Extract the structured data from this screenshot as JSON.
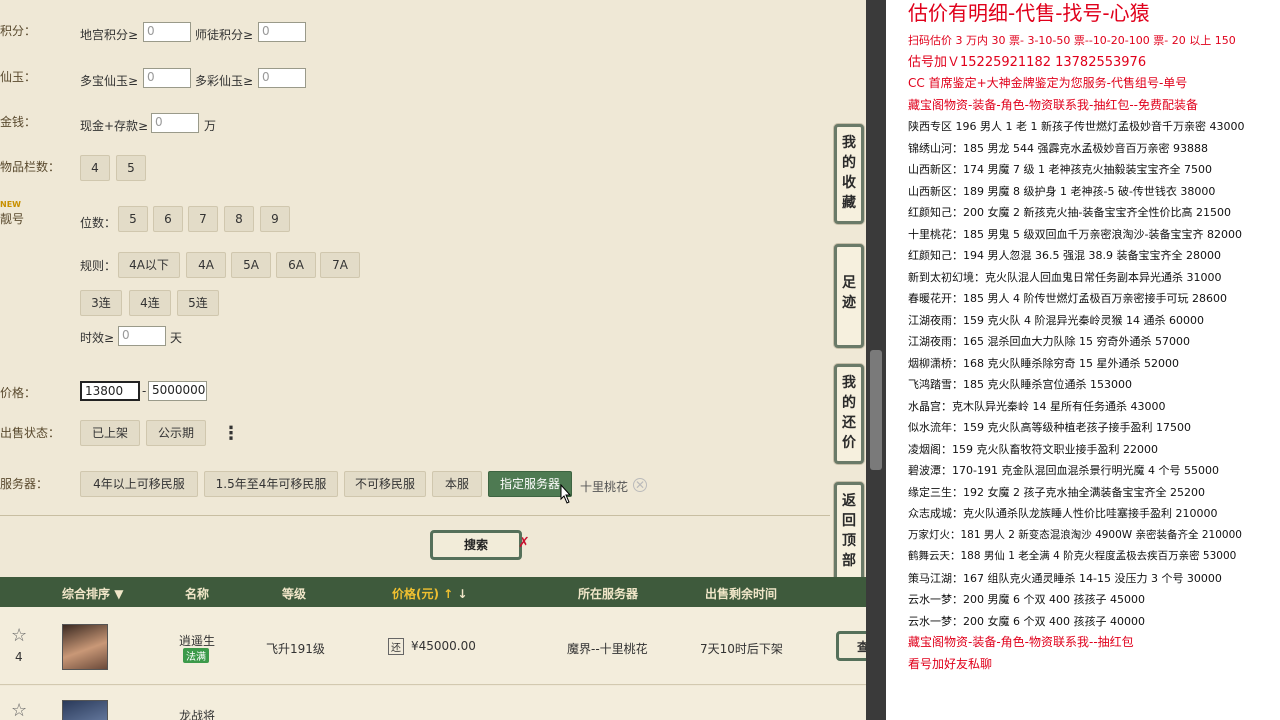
{
  "filters": {
    "dungeon_points": {
      "label": "积分：",
      "field1_label": "地宫积分≥",
      "field1_value": "0",
      "field2_label": "师徒积分≥",
      "field2_value": "0"
    },
    "immortal_jade": {
      "label": "仙玉：",
      "field1_label": "多宝仙玉≥",
      "field1_value": "0",
      "field2_label": "多彩仙玉≥",
      "field2_value": "0"
    },
    "money": {
      "label": "金钱：",
      "field_label": "现金+存款≥",
      "field_value": "0",
      "unit": "万"
    },
    "inventory": {
      "label": "物品栏数：",
      "options": [
        "4",
        "5"
      ]
    },
    "account_no": {
      "label": "靓号",
      "new_badge": "NEW",
      "digits_label": "位数：",
      "digits": [
        "5",
        "6",
        "7",
        "8",
        "9"
      ],
      "rules_label": "规则：",
      "rules": [
        "4A以下",
        "4A",
        "5A",
        "6A",
        "7A"
      ],
      "sequences": [
        "3连",
        "4连",
        "5连"
      ],
      "validity_label": "时效≥",
      "validity_value": "0",
      "validity_unit": "天"
    },
    "price": {
      "label": "价格：",
      "min": "13800",
      "sep": "-",
      "max": "5000000"
    },
    "sale_status": {
      "label": "出售状态：",
      "options": [
        "已上架",
        "公示期"
      ],
      "more": "⋮"
    },
    "server": {
      "label": "服务器：",
      "options": [
        "4年以上可移民服",
        "1.5年至4年可移民服",
        "不可移民服",
        "本服",
        "指定服务器"
      ],
      "selected_tag": "十里桃花",
      "close": "✕"
    }
  },
  "search_button": "搜索",
  "side_tabs": [
    "我的收藏",
    "足迹",
    "我的还价",
    "返回顶部"
  ],
  "table": {
    "headers": [
      "综合排序",
      "名称",
      "等级",
      "价格(元)",
      "所在服务器",
      "出售剩余时间"
    ],
    "rows": [
      {
        "rank": "4",
        "name": "逍遥生",
        "badge": "法满",
        "level": "飞升191级",
        "tag": "还",
        "price": "¥45000.00",
        "server": "魔界--十里桃花",
        "time": "7天10时后下架",
        "view": "查"
      },
      {
        "rank": "",
        "name": "龙战将",
        "badge": "",
        "level": "",
        "tag": "",
        "price": "",
        "server": "",
        "time": "",
        "view": ""
      }
    ]
  },
  "right_lines": [
    {
      "text": "估价有明细-代售-找号-心猿",
      "style": "big"
    },
    {
      "text": "扫码估价 3 万内 30 票- 3-10-50 票--10-20-100 票- 20 以上 150",
      "style": "red"
    },
    {
      "text": "估号加Ｖ15225921182   13782553976",
      "style": "red"
    },
    {
      "text": "CC 首席鉴定+大神金牌鉴定为您服务-代售组号-单号",
      "style": "red"
    },
    {
      "text": "藏宝阁物资-装备-角色-物资联系我-抽红包--免费配装备",
      "style": "red"
    },
    {
      "text": "陕西专区 196 男人 1 老 1 新孩子传世燃灯孟极妙音千万亲密 43000",
      "style": ""
    },
    {
      "text": "锦绣山河：185 男龙 544 强霹克水孟极妙音百万亲密 93888",
      "style": ""
    },
    {
      "text": "山西新区：174 男魔 7 级 1 老神孩克火抽毅装宝宝齐全 7500",
      "style": ""
    },
    {
      "text": "山西新区：189 男魔 8 级护身 1 老神孩-5 破-传世钱衣 38000",
      "style": ""
    },
    {
      "text": "红颜知己：200 女魔 2 新孩克火抽-装备宝宝齐全性价比高 21500",
      "style": ""
    },
    {
      "text": "十里桃花：185 男鬼 5 级双回血千万亲密浪淘沙-装备宝宝齐 82000",
      "style": ""
    },
    {
      "text": "红颜知己：194 男人忽混 36.5 强混 38.9 装备宝宝齐全 28000",
      "style": ""
    },
    {
      "text": "新到太初幻境：克火队混人回血鬼日常任务副本异光通杀 31000",
      "style": ""
    },
    {
      "text": "春暖花开：185 男人 4 阶传世燃灯孟极百万亲密接手可玩 28600",
      "style": ""
    },
    {
      "text": "江湖夜雨：159 克火队 4 阶混异光秦岭灵猴 14 通杀 60000",
      "style": ""
    },
    {
      "text": "江湖夜雨：165 混杀回血大力队除 15 穷奇外通杀 57000",
      "style": ""
    },
    {
      "text": "烟柳潇桥：168 克火队睡杀除穷奇 15 星外通杀 52000",
      "style": ""
    },
    {
      "text": "飞鸿踏雪：185 克火队睡杀宫位通杀 153000",
      "style": ""
    },
    {
      "text": "水晶宫：克木队异光秦岭 14 星所有任务通杀 43000",
      "style": ""
    },
    {
      "text": "似水流年：159 克火队高等级种植老孩子接手盈利 17500",
      "style": ""
    },
    {
      "text": "凌烟阁：159 克火队畜牧符文职业接手盈利 22000",
      "style": ""
    },
    {
      "text": "碧波潭：170-191 克金队混回血混杀景行明光魔 4 个号 55000",
      "style": ""
    },
    {
      "text": "缘定三生：192 女魔 2 孩子克水抽全满装备宝宝齐全 25200",
      "style": ""
    },
    {
      "text": "众志成城：克火队通杀队龙族睡人性价比哇塞接手盈利 210000",
      "style": ""
    },
    {
      "text": "万家灯火：181 男人 2 新变态混浪淘沙 4900W 亲密装备齐全 210000",
      "style": ""
    },
    {
      "text": "鹤舞云天：188 男仙 1 老全满 4 阶克火程度孟极去疾百万亲密 53000",
      "style": ""
    },
    {
      "text": "策马江湖：167 组队克火通灵睡杀 14-15 没压力 3 个号 30000",
      "style": ""
    },
    {
      "text": "云水一梦：200 男魔 6 个双 400 孩孩子 45000",
      "style": ""
    },
    {
      "text": "云水一梦：200 女魔 6 个双 400 孩孩子 40000",
      "style": ""
    },
    {
      "text": "藏宝阁物资-装备-角色-物资联系我--抽红包",
      "style": "red"
    },
    {
      "text": "看号加好友私聊",
      "style": "red"
    }
  ]
}
